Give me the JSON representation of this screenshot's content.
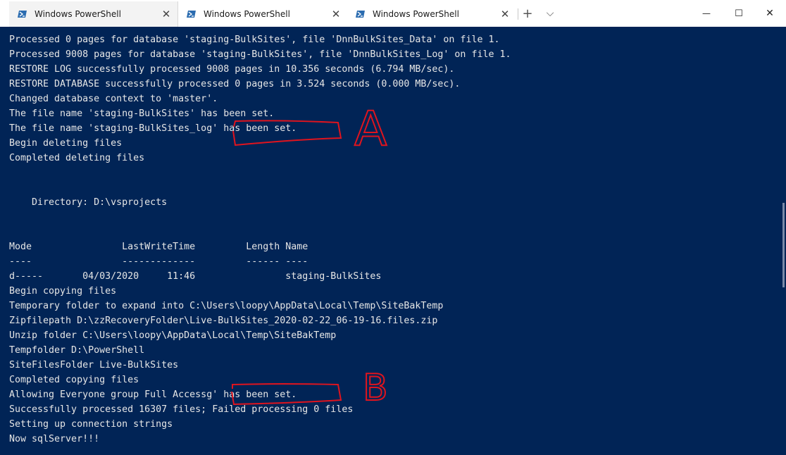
{
  "tabs": [
    {
      "label": "Windows PowerShell",
      "close": "✕",
      "icon": "powershell-icon",
      "active": true
    },
    {
      "label": "Windows PowerShell",
      "close": "✕",
      "icon": "powershell-icon",
      "active": false
    },
    {
      "label": "Windows PowerShell",
      "close": "✕",
      "icon": "powershell-icon",
      "active": false
    }
  ],
  "titlebar": {
    "new_tab": "+",
    "dropdown": "⌵",
    "minimize": "—",
    "maximize": "☐",
    "close": "✕"
  },
  "terminal": {
    "background": "#012456",
    "foreground": "#e6e6e6",
    "lines": [
      "Processed 0 pages for database 'staging-BulkSites', file 'DnnBulkSites_Data' on file 1.",
      "Processed 9008 pages for database 'staging-BulkSites', file 'DnnBulkSites_Log' on file 1.",
      "RESTORE LOG successfully processed 9008 pages in 10.356 seconds (6.794 MB/sec).",
      "RESTORE DATABASE successfully processed 0 pages in 3.524 seconds (0.000 MB/sec).",
      "Changed database context to 'master'.",
      "The file name 'staging-BulkSites' has been set.",
      "The file name 'staging-BulkSites_log' has been set.",
      "Begin deleting files",
      "Completed deleting files",
      "",
      "",
      "    Directory: D:\\vsprojects",
      "",
      "",
      "Mode                LastWriteTime         Length Name",
      "----                -------------         ------ ----",
      "d-----       04/03/2020     11:46                staging-BulkSites",
      "Begin copying files",
      "Temporary folder to expand into C:\\Users\\loopy\\AppData\\Local\\Temp\\SiteBakTemp",
      "Zipfilepath D:\\zzRecoveryFolder\\Live-BulkSites_2020-02-22_06-19-16.files.zip",
      "Unzip folder C:\\Users\\loopy\\AppData\\Local\\Temp\\SiteBakTemp",
      "Tempfolder D:\\PowerShell",
      "SiteFilesFolder Live-BulkSites",
      "Completed copying files",
      "Allowing Everyone group Full Accessg' has been set.",
      "Successfully processed 16307 files; Failed processing 0 files",
      "Setting up connection strings",
      "Now sqlServer!!!"
    ]
  },
  "annotations": {
    "a_label": "A",
    "b_label": "B",
    "color": "#e0141e"
  }
}
